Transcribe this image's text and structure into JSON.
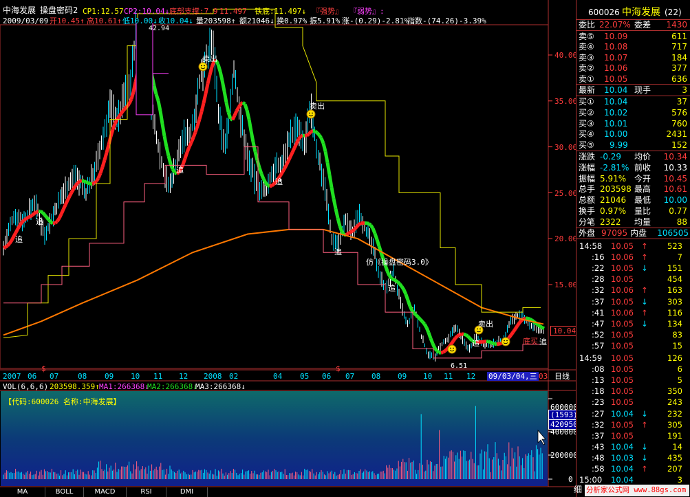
{
  "header": {
    "name": "中海发展",
    "formula": "操盘密码2",
    "cp1": "CP1:12.57",
    "cp2": "CP2:10.04↓",
    "bottom": "底部支撑:7.9",
    "v1": "11.497",
    "iron": "铁底:11.497↓",
    "strong": "『强势』",
    "weak": "『弱势』:"
  },
  "header2": {
    "date": "2009/03/09",
    "open": "开10.45↑",
    "high": "高10.61↑",
    "low": "低10.00↓",
    "close": "收10.04↓",
    "vol": "量203598↑",
    "amt": "额21046↓",
    "turn": "换0.97%",
    "amp": "振5.91%",
    "chg": "涨-(0.29)-2.81%",
    "idx": "指数-(74.26)-3.39%"
  },
  "chart_labels": {
    "peak": "42.94",
    "trough": "6.51",
    "sell1": "卖出",
    "sell2": "卖出",
    "sell3": "卖出",
    "chase": "追",
    "fake": "仿《操盘密码3.0》",
    "bottom_buy": "底买",
    "last_price": "10.04",
    "code_label": "【代码:600026 名称:中海发展】"
  },
  "y_axis": [
    "40.00",
    "35.00",
    "30.00",
    "25.00",
    "20.00",
    "15.00",
    "10.04"
  ],
  "x_axis": {
    "labels": [
      "2007",
      "06",
      "07",
      "08",
      "09",
      "10",
      "11",
      "12",
      "2008",
      "02",
      "04",
      "05",
      "06",
      "07",
      "08",
      "09",
      "10",
      "11",
      "12"
    ],
    "cursor": "09/03/04,三",
    "cursor2": "03",
    "period": "日线",
    "markers": [
      "$",
      "$"
    ]
  },
  "vol_header": {
    "vol": "VOL(6,6,6)",
    "vval": "203598.359↑",
    "ma1": "MA1:266368↓",
    "ma2": "MA2:266368↓",
    "ma3": "MA3:266368↓"
  },
  "vol_axis": [
    "600000",
    "400000",
    "200000",
    "0"
  ],
  "vol_box": {
    "a": "(1593)",
    "b": "420950"
  },
  "tabs": [
    "MA",
    "BOLL",
    "MACD",
    "RSI",
    "DMI"
  ],
  "panel": {
    "code": "600026",
    "name": "中海发展",
    "count": "(22)",
    "weibi_label": "委比",
    "weibi": "22.07%",
    "weicha_label": "委差",
    "weicha": "1430",
    "sells": [
      {
        "l": "卖⑤",
        "p": "10.09",
        "v": "611"
      },
      {
        "l": "卖④",
        "p": "10.08",
        "v": "717"
      },
      {
        "l": "卖③",
        "p": "10.07",
        "v": "184"
      },
      {
        "l": "卖②",
        "p": "10.06",
        "v": "377"
      },
      {
        "l": "卖①",
        "p": "10.05",
        "v": "636"
      }
    ],
    "last_label": "最新",
    "last": "10.04",
    "now_label": "现手",
    "now": "3",
    "buys": [
      {
        "l": "买①",
        "p": "10.04",
        "v": "37"
      },
      {
        "l": "买②",
        "p": "10.02",
        "v": "576"
      },
      {
        "l": "买③",
        "p": "10.01",
        "v": "760"
      },
      {
        "l": "买④",
        "p": "10.00",
        "v": "2431"
      },
      {
        "l": "买⑤",
        "p": "9.99",
        "v": "152"
      }
    ],
    "stats": [
      {
        "a": "涨跌",
        "b": "-0.29",
        "c": "均价",
        "d": "10.34"
      },
      {
        "a": "涨幅",
        "b": "-2.81%",
        "c": "前收",
        "d": "10.33"
      },
      {
        "a": "振幅",
        "b": "5.91%",
        "c": "今开",
        "d": "10.45"
      },
      {
        "a": "总手",
        "b": "203598",
        "c": "最高",
        "d": "10.61"
      },
      {
        "a": "总额",
        "b": "21046",
        "c": "最低",
        "d": "10.00"
      },
      {
        "a": "换手",
        "b": "0.97%",
        "c": "量比",
        "d": "0.77"
      },
      {
        "a": "分笔",
        "b": "2322",
        "c": "均量",
        "d": "88"
      }
    ],
    "outer_label": "外盘",
    "outer": "97095",
    "inner_label": "内盘",
    "inner": "106505",
    "ticks": [
      {
        "t": "14:58",
        "p": "10.05",
        "v": "523",
        "a": "↑"
      },
      {
        "t": ":16",
        "p": "10.06",
        "v": "7",
        "a": "↑"
      },
      {
        "t": ":22",
        "p": "10.05",
        "v": "151",
        "a": "↓"
      },
      {
        "t": ":28",
        "p": "10.05",
        "v": "454",
        "a": ""
      },
      {
        "t": ":32",
        "p": "10.06",
        "v": "163",
        "a": "↑"
      },
      {
        "t": ":37",
        "p": "10.05",
        "v": "303",
        "a": "↓"
      },
      {
        "t": ":41",
        "p": "10.06",
        "v": "116",
        "a": "↑"
      },
      {
        "t": ":47",
        "p": "10.05",
        "v": "134",
        "a": "↓"
      },
      {
        "t": ":52",
        "p": "10.05",
        "v": "83",
        "a": ""
      },
      {
        "t": ":57",
        "p": "10.05",
        "v": "15",
        "a": ""
      },
      {
        "t": "14:59",
        "p": "10.05",
        "v": "126",
        "a": ""
      },
      {
        "t": ":08",
        "p": "10.05",
        "v": "6",
        "a": ""
      },
      {
        "t": ":13",
        "p": "10.05",
        "v": "5",
        "a": ""
      },
      {
        "t": ":18",
        "p": "10.05",
        "v": "350",
        "a": ""
      },
      {
        "t": ":23",
        "p": "10.05",
        "v": "243",
        "a": ""
      },
      {
        "t": ":27",
        "p": "10.04",
        "v": "232",
        "a": "↓"
      },
      {
        "t": ":32",
        "p": "10.05",
        "v": "305",
        "a": "↑"
      },
      {
        "t": ":37",
        "p": "10.05",
        "v": "191",
        "a": ""
      },
      {
        "t": ":43",
        "p": "10.04",
        "v": "14",
        "a": "↓"
      },
      {
        "t": ":48",
        "p": "10.03",
        "v": "435",
        "a": "↓"
      },
      {
        "t": ":58",
        "p": "10.04",
        "v": "207",
        "a": "↑"
      },
      {
        "t": "15:00",
        "p": "10.04",
        "v": "3",
        "a": ""
      }
    ],
    "footer": "细",
    "watermark": "分析家公式网 www.88gs.com"
  },
  "colors": {
    "up": "#ff3c3c",
    "down": "#00e0ff",
    "yellow": "#ffff00",
    "white": "#ffffff",
    "magenta": "#ff40ff",
    "green": "#20e020",
    "orange": "#ff7800",
    "grid": "#b03030"
  }
}
